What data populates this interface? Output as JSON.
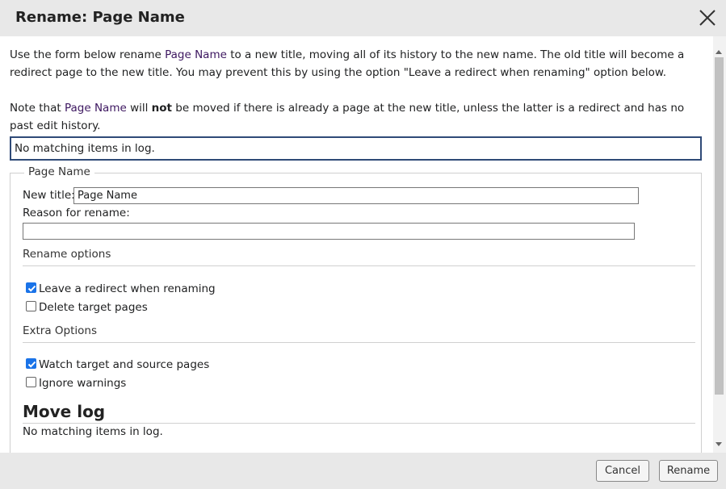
{
  "dialog": {
    "title": "Rename: Page Name",
    "intro": {
      "prefix": "Use the form below rename ",
      "page_link": "Page Name",
      "suffix": " to a new title, moving all of its history to the new name. The old title will become a redirect page to the new title. You may prevent this by using the option \"Leave a redirect when renaming\" option below."
    },
    "note": {
      "prefix": "Note that ",
      "page_link": "Page Name",
      "middle": " will ",
      "emphasis": "not",
      "suffix": " be moved if there is already a page at the new title, unless the latter is a redirect and has no past edit history."
    },
    "top_log_message": "No matching items in log."
  },
  "form": {
    "legend": "Page Name",
    "new_title_label": "New title:",
    "new_title_value": "Page Name",
    "reason_label": "Reason for rename:",
    "reason_value": "",
    "rename_options_heading": "Rename options",
    "rename_options": [
      {
        "label": "Leave a redirect when renaming",
        "checked": true
      },
      {
        "label": "Delete target pages",
        "checked": false
      }
    ],
    "extra_options_heading": "Extra Options",
    "extra_options": [
      {
        "label": "Watch target and source pages",
        "checked": true
      },
      {
        "label": "Ignore warnings",
        "checked": false
      }
    ],
    "move_log_heading": "Move log",
    "move_log_message": "No matching items in log."
  },
  "footer": {
    "cancel_label": "Cancel",
    "rename_label": "Rename"
  },
  "colors": {
    "accent": "#1a73e8",
    "link": "#3d1760",
    "chrome": "#e8e8e8",
    "log_border": "#2f4a77"
  }
}
